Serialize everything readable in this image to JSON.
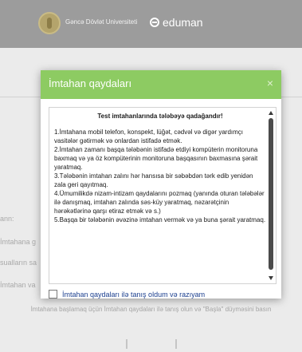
{
  "header": {
    "university": "Gəncə Dövlət Universiteti",
    "brand": "eduman"
  },
  "background": {
    "labels": [
      "ann:",
      "İmtahana g",
      "sualların sa",
      "İmtahan va"
    ],
    "instruction": "İmtahana başlamaq üçün İmtahan qaydaları ilə tanış olun və \"Başla\" düyməsini basın"
  },
  "modal": {
    "title": "İmtahan qaydaları",
    "close": "×",
    "heading": "Test imtahanlarında tələbəyə qadağandır!",
    "rules": [
      "1.İmtahana mobil telefon, konspekt, lüğət, cədvəl və digər yardımçı vasitələr gətirmək və onlardan istifadə etmək.",
      "2.İmtahan zamanı başqa tələbənin istifadə etdiyi kompüterin monitoruna baxmaq və ya öz kompüterinin monitoruna başqasının baxmasına şərait yaratmaq.",
      "3.Tələbənin imtahan zalını hər hansısa bir səbəbdən tərk edib yenidən zala geri qayıtmaq.",
      "4.Ümumilikdə nizam-intizam qaydalarını pozmaq (yanında oturan tələbələr ilə danışmaq, imtahan zalında səs-küy yaratmaq, nəzarətçinin hərəkətlərinə qarşı etiraz etmək və s.)",
      "5.Başqa bir tələbənin əvəzinə imtahan vermək və ya buna şərait yaratmaq."
    ],
    "agree_label": "İmtahan qaydaları ilə tanış oldum və razıyam",
    "agree_checked": false
  },
  "colors": {
    "modal_header": "#8dcb62",
    "page_header": "#9c9c9c",
    "link_text": "#1b3f8f"
  }
}
